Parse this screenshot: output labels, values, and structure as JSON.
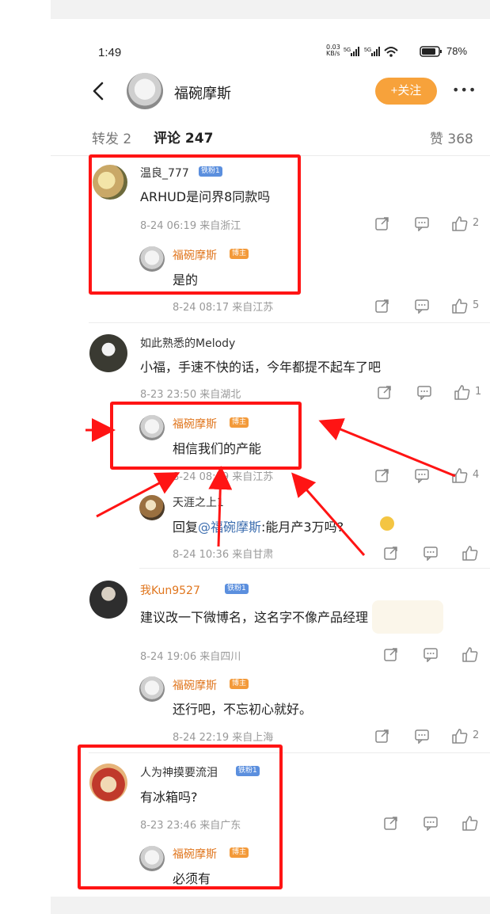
{
  "status_bar": {
    "time": "1:49",
    "net_speed_top": "0.03",
    "net_speed_unit": "KB/s",
    "battery": "78%"
  },
  "header": {
    "title": "福碗摩斯",
    "follow_label": "+关注",
    "more_label": "•••"
  },
  "tabs": {
    "repost": "转发 2",
    "comments": "评论 247",
    "likes": "赞 368"
  },
  "comments": [
    {
      "user": "温良_777",
      "badge": "铁粉1",
      "text": "ARHUD是问界8同款吗",
      "meta": "8-24 06:19  来自浙江",
      "likes": "2",
      "reply": {
        "user": "福碗摩斯",
        "badge": "博主",
        "text": "是的",
        "meta": "8-24 08:17  来自江苏",
        "likes": "5"
      }
    },
    {
      "user": "如此熟悉的Melody",
      "text": "小福，手速不快的话，今年都提不起车了吧",
      "meta": "8-23 23:50  来自湖北",
      "likes": "1",
      "reply": {
        "user": "福碗摩斯",
        "badge": "博主",
        "text": "相信我们的产能",
        "meta": "8-24 08:19  来自江苏",
        "likes": "4"
      },
      "reply2": {
        "user": "天涯之上1",
        "prefix": "回复",
        "mention": "@福碗摩斯",
        "text": ":能月产3万吗?",
        "meta": "8-24 10:36  来自甘肃"
      }
    },
    {
      "user": "我Kun9527",
      "badge": "铁粉1",
      "text": "建议改一下微博名，这名字不像产品经理",
      "meta": "8-24 19:06  来自四川",
      "reply": {
        "user": "福碗摩斯",
        "badge": "博主",
        "text": "还行吧，不忘初心就好。",
        "meta": "8-24 22:19  来自上海",
        "likes": "2"
      }
    },
    {
      "user": "人为神摸要流泪",
      "badge": "铁粉1",
      "text": "有冰箱吗?",
      "meta": "8-23 23:46  来自广东",
      "reply": {
        "user": "福碗摩斯",
        "badge": "博主",
        "text": "必须有"
      }
    }
  ],
  "colors": {
    "accent": "#f7a23b",
    "highlight": "#ff1414",
    "link": "#3e6fb0"
  }
}
